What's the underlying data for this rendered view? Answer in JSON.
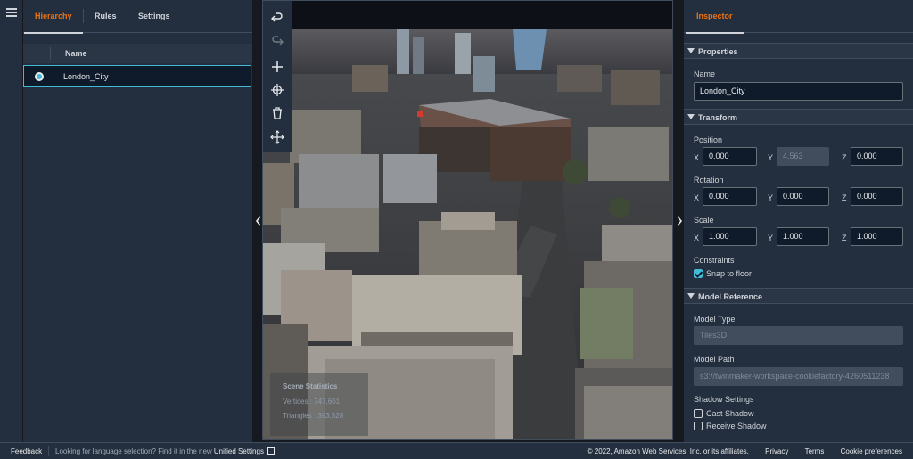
{
  "left_panel": {
    "tabs": [
      {
        "label": "Hierarchy",
        "active": true
      },
      {
        "label": "Rules",
        "active": false
      },
      {
        "label": "Settings",
        "active": false
      }
    ],
    "table_header": "Name",
    "items": [
      {
        "label": "London_City",
        "selected": true
      }
    ]
  },
  "viewport": {
    "toolbar": [
      {
        "name": "undo-icon",
        "enabled": true
      },
      {
        "name": "redo-icon",
        "enabled": false
      },
      {
        "name": "add-icon",
        "enabled": true
      },
      {
        "name": "target-icon",
        "enabled": true
      },
      {
        "name": "trash-icon",
        "enabled": true
      },
      {
        "name": "move-icon",
        "enabled": true
      }
    ],
    "stats": {
      "title": "Scene Statistics",
      "vertices": "Vertices : 747,601",
      "triangles": "Triangles : 393,528"
    }
  },
  "inspector": {
    "tab": "Inspector",
    "sections": {
      "properties": "Properties",
      "transform": "Transform",
      "model_reference": "Model Reference"
    },
    "name_label": "Name",
    "name_value": "London_City",
    "position": {
      "label": "Position",
      "x": "0.000",
      "y": "4.563",
      "z": "0.000"
    },
    "rotation": {
      "label": "Rotation",
      "x": "0.000",
      "y": "0.000",
      "z": "0.000"
    },
    "scale": {
      "label": "Scale",
      "x": "1.000",
      "y": "1.000",
      "z": "1.000"
    },
    "axis": {
      "x": "X",
      "y": "Y",
      "z": "Z"
    },
    "constraints": {
      "label": "Constraints",
      "snap_label": "Snap to floor",
      "snap_checked": true
    },
    "model_type": {
      "label": "Model Type",
      "value": "Tiles3D"
    },
    "model_path": {
      "label": "Model Path",
      "value": "s3://twinmaker-workspace-cookiefactory-4260511238"
    },
    "shadow": {
      "label": "Shadow Settings",
      "cast": "Cast Shadow",
      "receive": "Receive Shadow",
      "cast_checked": false,
      "receive_checked": false
    }
  },
  "footer": {
    "feedback": "Feedback",
    "message": "Looking for language selection? Find it in the new",
    "settings_link": "Unified Settings",
    "copyright": "© 2022, Amazon Web Services, Inc. or its affiliates.",
    "links": [
      "Privacy",
      "Terms",
      "Cookie preferences"
    ]
  },
  "colors": {
    "accent": "#ec7211",
    "selection": "#44b9d6",
    "panel": "#232f3e"
  }
}
